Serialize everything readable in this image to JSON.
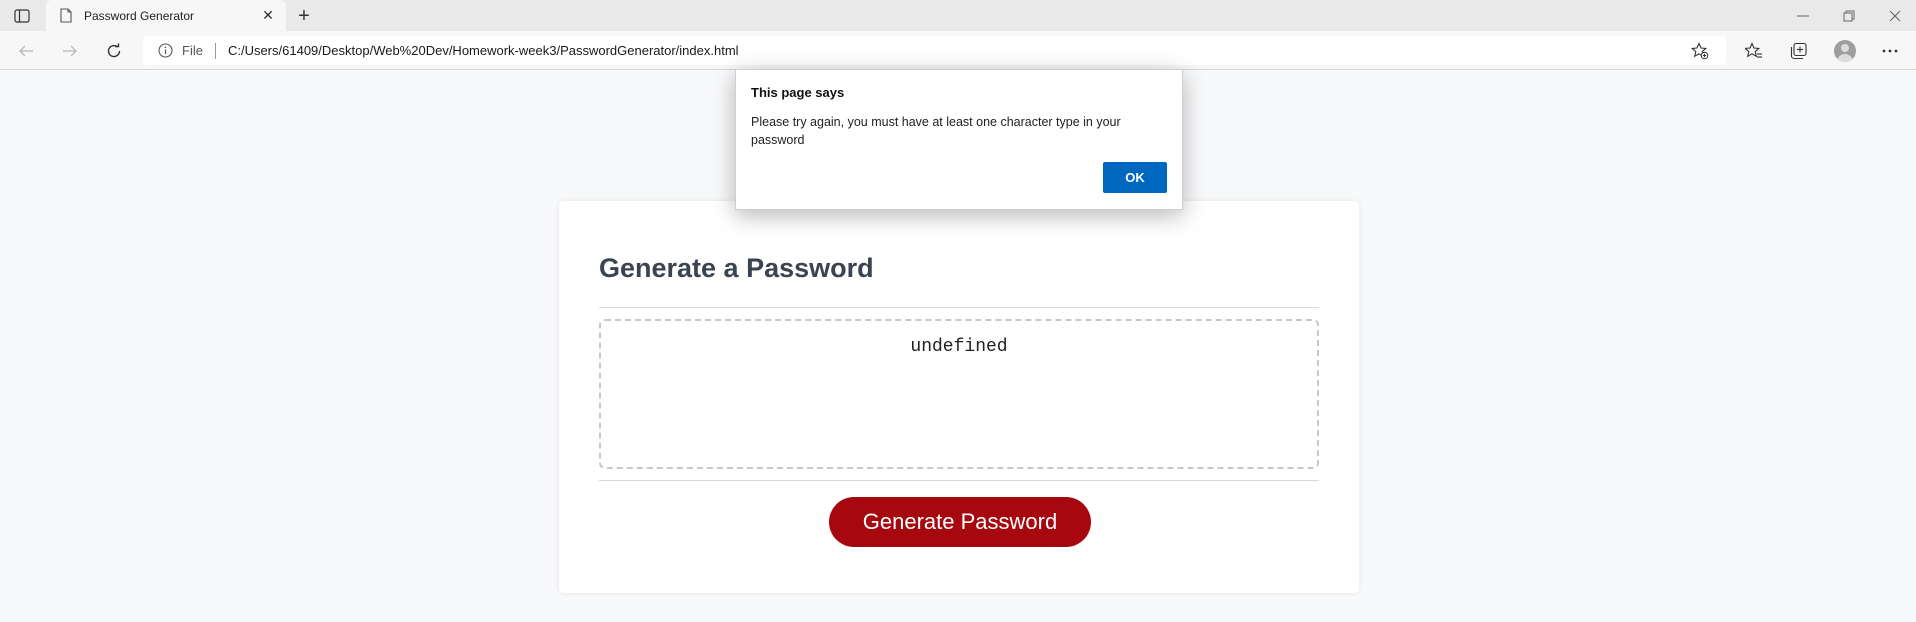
{
  "browser": {
    "tab": {
      "title": "Password Generator"
    },
    "address": {
      "scheme": "File",
      "url": "C:/Users/61409/Desktop/Web%20Dev/Homework-week3/PasswordGenerator/index.html"
    }
  },
  "page": {
    "title": "Generate a Password",
    "password_output": "undefined",
    "generate_label": "Generate Password"
  },
  "dialog": {
    "title": "This page says",
    "message": "Please try again, you must have at least one character type in your password",
    "ok_label": "OK"
  },
  "colors": {
    "button_red": "#a7080f",
    "ok_blue": "#0067c0",
    "heading": "#3a4350"
  }
}
